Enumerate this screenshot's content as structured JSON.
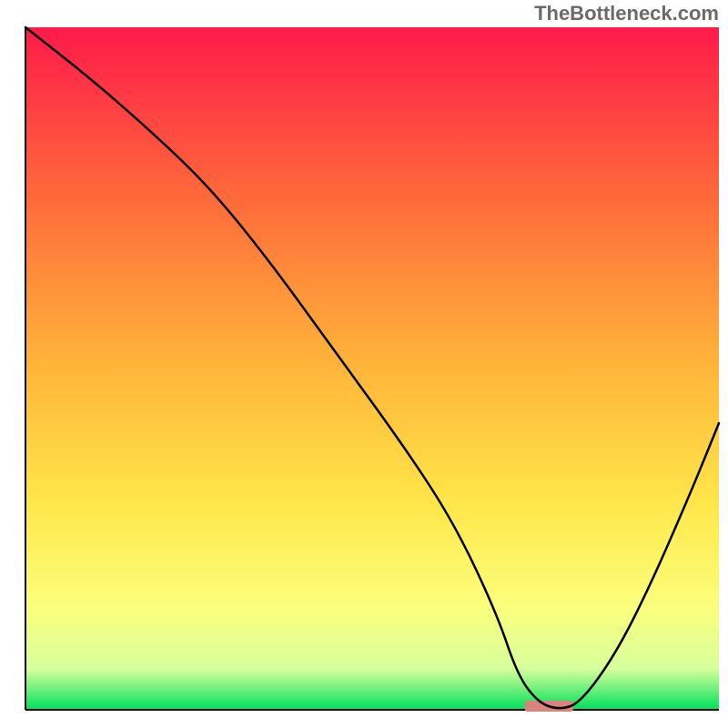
{
  "watermark": "TheBottleneck.com",
  "chart_data": {
    "type": "line",
    "title": "",
    "xlabel": "",
    "ylabel": "",
    "xlim": [
      0,
      100
    ],
    "ylim": [
      0,
      100
    ],
    "gradient_stops": [
      {
        "offset": 0,
        "color": "#ff1a4a"
      },
      {
        "offset": 25,
        "color": "#ff6a3a"
      },
      {
        "offset": 50,
        "color": "#ffb63a"
      },
      {
        "offset": 70,
        "color": "#ffe74a"
      },
      {
        "offset": 85,
        "color": "#fbff7c"
      },
      {
        "offset": 94,
        "color": "#d7ff9c"
      },
      {
        "offset": 100,
        "color": "#00e05a"
      }
    ],
    "curve": {
      "x": [
        0,
        10,
        20,
        27,
        35,
        45,
        55,
        62,
        68,
        71,
        74,
        77,
        80,
        85,
        90,
        96,
        100
      ],
      "y": [
        100,
        92,
        83,
        76,
        66,
        52,
        38,
        27,
        14,
        5,
        1,
        0,
        1,
        8,
        18,
        32,
        42
      ]
    },
    "marker": {
      "x_start": 72,
      "x_end": 79,
      "y": 0,
      "rx": 3,
      "color": "#d9837c"
    },
    "axes_color": "#000000",
    "axes_width": 2,
    "curve_color": "#000000",
    "curve_width": 2.5
  }
}
